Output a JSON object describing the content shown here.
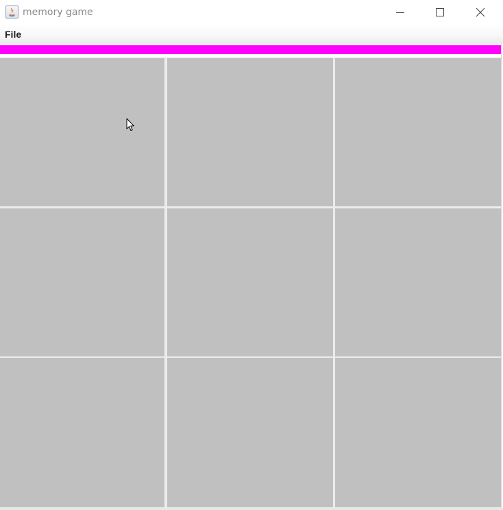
{
  "window": {
    "title": "memory game",
    "icon": "java-app-icon"
  },
  "controls": {
    "minimize_icon": "minimize-icon",
    "maximize_icon": "maximize-icon",
    "close_icon": "close-icon"
  },
  "menu": {
    "items": [
      {
        "label": "File"
      }
    ]
  },
  "timer": {
    "color": "#ff00ff",
    "fraction_remaining": 1.0
  },
  "board": {
    "rows": 3,
    "columns": 3,
    "card_back_color": "#c0c0c0",
    "cards": [
      {
        "state": "face-down"
      },
      {
        "state": "face-down"
      },
      {
        "state": "face-down"
      },
      {
        "state": "face-down"
      },
      {
        "state": "face-down"
      },
      {
        "state": "face-down"
      },
      {
        "state": "face-down"
      },
      {
        "state": "face-down"
      },
      {
        "state": "face-down"
      }
    ]
  }
}
